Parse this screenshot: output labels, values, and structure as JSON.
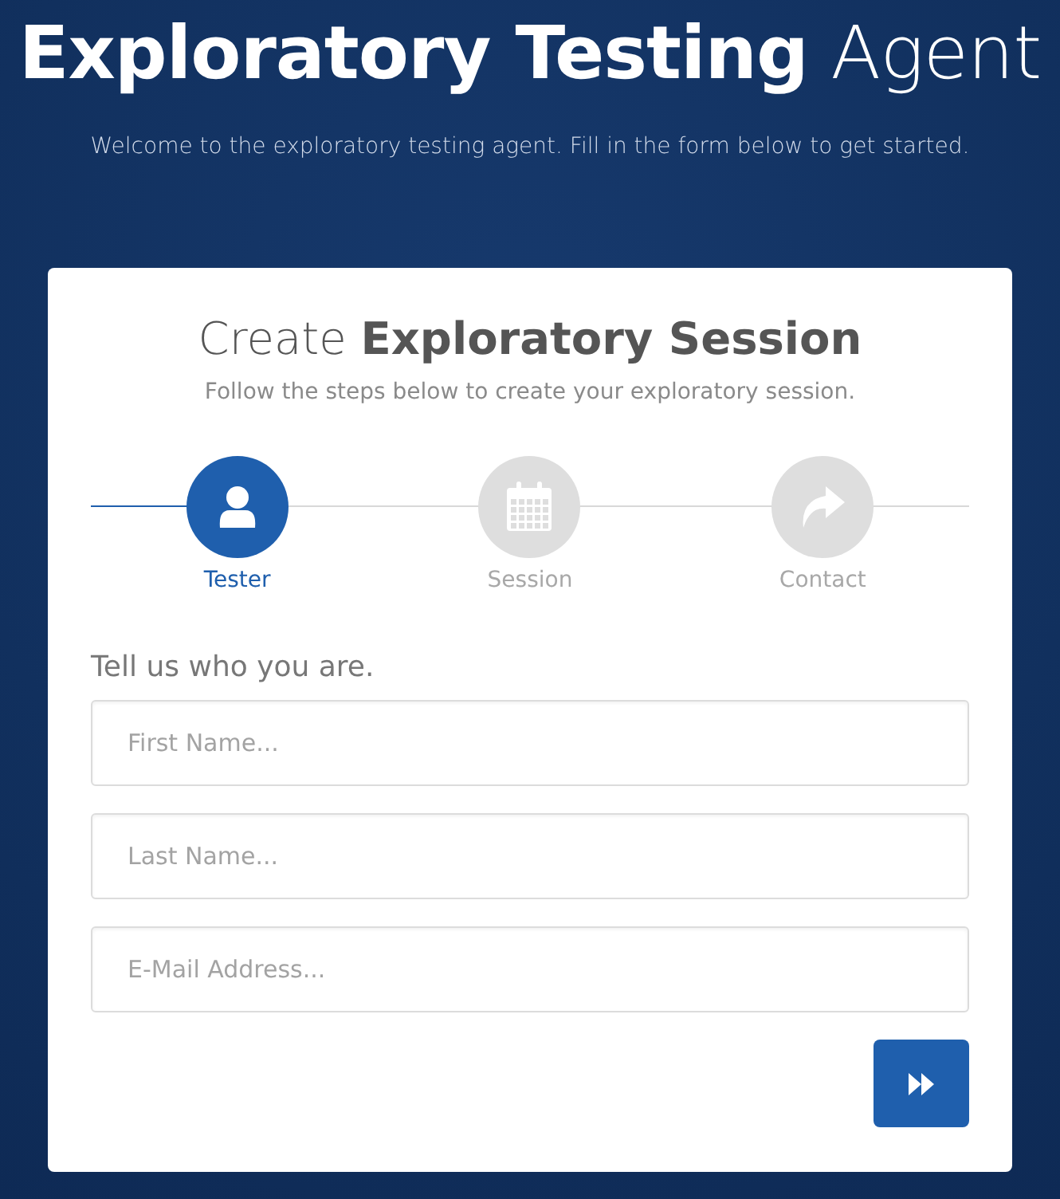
{
  "header": {
    "title": "**Exploratory Testing** Agent",
    "subtitle": "Welcome to the exploratory testing agent. Fill in the form below to get started."
  },
  "card": {
    "title": "Create **Exploratory Session**",
    "subtitle": "Follow the steps below to create your exploratory session.",
    "steps": [
      {
        "kind": "user",
        "label": "Tester",
        "selected": true
      },
      {
        "kind": "calendar",
        "label": "Session",
        "selected": false
      },
      {
        "kind": "share",
        "label": "Contact",
        "selected": false
      }
    ],
    "section_title": "Tell us who you are.",
    "fields": [
      {
        "placeholder": "First Name..."
      },
      {
        "placeholder": "Last Name..."
      },
      {
        "placeholder": "E-Mail Address..."
      }
    ]
  }
}
